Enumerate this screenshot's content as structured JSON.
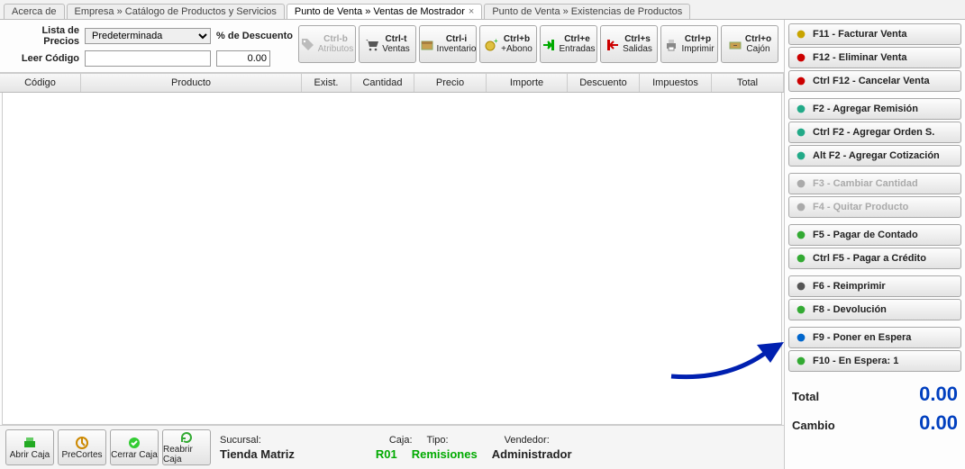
{
  "tabs": [
    {
      "label": "Acerca de",
      "active": false,
      "closable": false
    },
    {
      "label": "Empresa » Catálogo de Productos y Servicios",
      "active": false,
      "closable": false
    },
    {
      "label": "Punto de Venta » Ventas de Mostrador",
      "active": true,
      "closable": true
    },
    {
      "label": "Punto de Venta » Existencias de Productos",
      "active": false,
      "closable": false
    }
  ],
  "fields": {
    "lista_precios_label": "Lista de Precios",
    "lista_precios_value": "Predeterminada",
    "descuento_label": "% de Descuento",
    "descuento_value": "0.00",
    "leer_codigo_label": "Leer Código",
    "leer_codigo_value": ""
  },
  "shortcuts": [
    {
      "key": "Ctrl-b",
      "label": "Atributos",
      "icon": "tag-icon",
      "disabled": true
    },
    {
      "key": "Ctrl-t",
      "label": "Ventas",
      "icon": "cart-icon"
    },
    {
      "key": "Ctrl-i",
      "label": "Inventario",
      "icon": "box-icon"
    },
    {
      "key": "Ctrl+b",
      "label": "+Abono",
      "icon": "coin-plus-icon"
    },
    {
      "key": "Ctrl+e",
      "label": "Entradas",
      "icon": "in-icon"
    },
    {
      "key": "Ctrl+s",
      "label": "Salidas",
      "icon": "out-icon"
    },
    {
      "key": "Ctrl+p",
      "label": "Imprimir",
      "icon": "printer-icon"
    },
    {
      "key": "Ctrl+o",
      "label": "Cajón",
      "icon": "drawer-icon"
    }
  ],
  "grid": {
    "columns": [
      "Código",
      "Producto",
      "Exist.",
      "Cantidad",
      "Precio",
      "Importe",
      "Descuento",
      "Impuestos",
      "Total"
    ],
    "rows": []
  },
  "bottom_buttons": [
    {
      "label": "Abrir Caja",
      "icon": "open-register-icon"
    },
    {
      "label": "PreCortes",
      "icon": "precut-icon"
    },
    {
      "label": "Cerrar Caja",
      "icon": "close-register-icon"
    },
    {
      "label": "Reabrir Caja",
      "icon": "reopen-register-icon"
    }
  ],
  "status": {
    "sucursal_label": "Sucursal:",
    "sucursal_value": "Tienda Matriz",
    "caja_label": "Caja:",
    "caja_value": "R01",
    "tipo_label": "Tipo:",
    "tipo_value": "Remisiones",
    "vendedor_label": "Vendedor:",
    "vendedor_value": "Administrador"
  },
  "actions": [
    {
      "label": "F11 - Facturar Venta",
      "icon": "invoice-icon",
      "color": "#c8a400"
    },
    {
      "label": "F12 - Eliminar Venta",
      "icon": "delete-icon",
      "color": "#c00"
    },
    {
      "label": "Ctrl F12 - Cancelar Venta",
      "icon": "cancel-icon",
      "color": "#c00"
    },
    {
      "label": "F2 - Agregar Remisión",
      "icon": "add-remision-icon",
      "color": "#2a8"
    },
    {
      "label": "Ctrl F2 - Agregar Orden S.",
      "icon": "add-order-icon",
      "color": "#2a8"
    },
    {
      "label": "Alt F2 - Agregar Cotización",
      "icon": "add-quote-icon",
      "color": "#2a8"
    },
    {
      "label": "F3 - Cambiar Cantidad",
      "icon": "qty-icon",
      "disabled": true,
      "color": "#aaa"
    },
    {
      "label": "F4 - Quitar Producto",
      "icon": "remove-icon",
      "disabled": true,
      "color": "#aaa"
    },
    {
      "label": "F5 - Pagar de Contado",
      "icon": "cash-icon",
      "color": "#3a3"
    },
    {
      "label": "Ctrl F5 - Pagar a Crédito",
      "icon": "credit-icon",
      "color": "#3a3"
    },
    {
      "label": "F6 - Reimprimir",
      "icon": "reprint-icon",
      "color": "#555"
    },
    {
      "label": "F8 - Devolución",
      "icon": "return-icon",
      "color": "#3a3"
    },
    {
      "label": "F9 - Poner en Espera",
      "icon": "hold-icon",
      "color": "#06c"
    },
    {
      "label": "F10 - En Espera: 1",
      "icon": "waiting-icon",
      "color": "#3a3"
    }
  ],
  "totals": {
    "total_label": "Total",
    "total_value": "0.00",
    "cambio_label": "Cambio",
    "cambio_value": "0.00"
  }
}
